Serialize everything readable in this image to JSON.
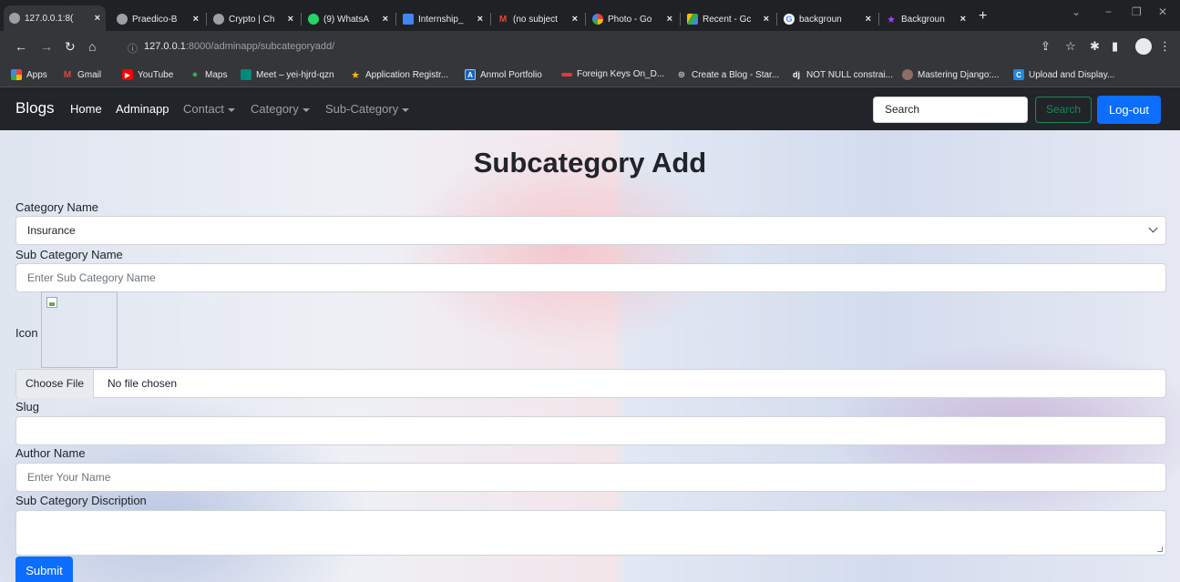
{
  "browser": {
    "tabs": [
      {
        "title": "127.0.0.1:8(",
        "active": true,
        "icon": "globe-icon"
      },
      {
        "title": "Praedico-B",
        "icon": "globe-icon"
      },
      {
        "title": "Crypto | Ch",
        "icon": "globe-icon"
      },
      {
        "title": "(9) WhatsA",
        "icon": "whatsapp-icon"
      },
      {
        "title": "Internship_",
        "icon": "docs-icon"
      },
      {
        "title": "(no subject",
        "icon": "gmail-icon"
      },
      {
        "title": "Photo - Go",
        "icon": "photos-icon"
      },
      {
        "title": "Recent - Gc",
        "icon": "drive-icon"
      },
      {
        "title": "backgroun",
        "icon": "google-icon"
      },
      {
        "title": "Backgroun",
        "icon": "star-icon"
      }
    ],
    "new_tab": "+",
    "url_host": "127.0.0.1",
    "url_rest": ":8000/adminapp/subcategoryadd/",
    "bookmarks": [
      {
        "label": "Apps",
        "icon": "apps-icon"
      },
      {
        "label": "Gmail",
        "icon": "gmail-icon"
      },
      {
        "label": "YouTube",
        "icon": "youtube-icon"
      },
      {
        "label": "Maps",
        "icon": "maps-icon"
      },
      {
        "label": "Meet – yei-hjrd-qzn",
        "icon": "meet-icon"
      },
      {
        "label": "Application Registr...",
        "icon": "star-icon"
      },
      {
        "label": "Anmol Portfolio",
        "icon": "portfolio-icon"
      },
      {
        "label": "Foreign Keys On_D...",
        "icon": "bookmark-icon"
      },
      {
        "label": "Create a Blog - Star...",
        "icon": "blog-icon"
      },
      {
        "label": "NOT NULL constrai...",
        "icon": "django-icon"
      },
      {
        "label": "Mastering Django:...",
        "icon": "avatar-icon"
      },
      {
        "label": "Upload and Display...",
        "icon": "c-icon"
      }
    ]
  },
  "site_nav": {
    "brand": "Blogs",
    "links": [
      "Home",
      "Adminapp"
    ],
    "dropdowns": [
      "Contact",
      "Category",
      "Sub-Category"
    ],
    "search_placeholder": "Search",
    "search_button": "Search",
    "logout_button": "Log-out"
  },
  "form": {
    "title": "Subcategory Add",
    "category_label": "Category Name",
    "category_value": "Insurance",
    "subcategory_label": "Sub Category Name",
    "subcategory_placeholder": "Enter Sub Category Name",
    "icon_label": "Icon",
    "file_button": "Choose File",
    "file_status": "No file chosen",
    "slug_label": "Slug",
    "author_label": "Author Name",
    "author_placeholder": "Enter Your Name",
    "description_label": "Sub Category Discription",
    "submit": "Submit"
  },
  "colors": {
    "primary": "#0d6efd",
    "success": "#198754",
    "navbar": "#212529"
  }
}
